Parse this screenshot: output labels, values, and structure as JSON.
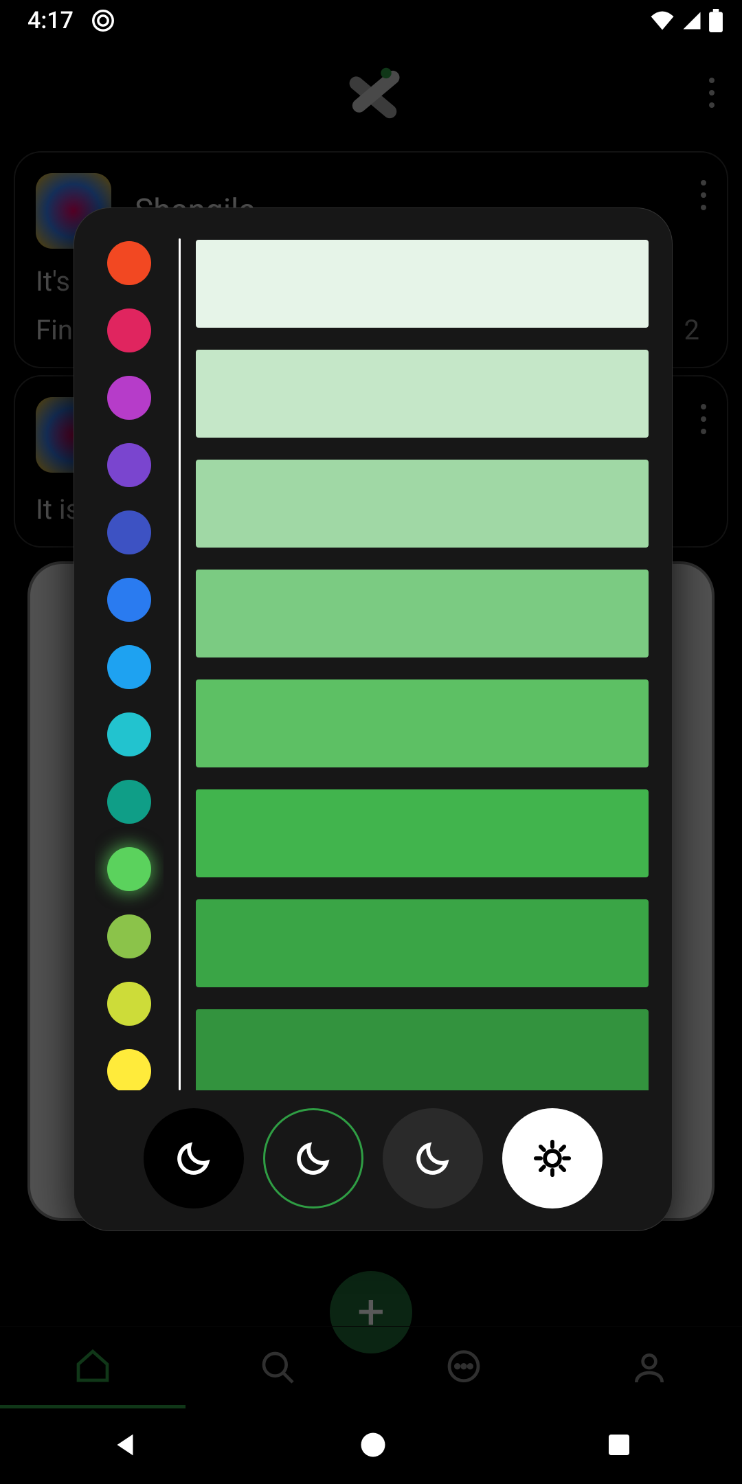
{
  "status_bar": {
    "time": "4:17",
    "icons": {
      "screensaver": "screensaver-icon",
      "wifi": "wifi-icon",
      "signal": "signal-icon",
      "battery": "battery-icon"
    }
  },
  "backdrop": {
    "cards": [
      {
        "title": "Shangila",
        "lines": [
          "It's t",
          "Fina"
        ],
        "badge": "2"
      },
      {
        "lines": [
          "It is"
        ]
      }
    ],
    "fab_label": "+",
    "nav": [
      "home",
      "search",
      "chat",
      "profile"
    ]
  },
  "color_picker": {
    "hues": [
      {
        "name": "red",
        "color": "#f24822"
      },
      {
        "name": "pink",
        "color": "#e0255f"
      },
      {
        "name": "magenta",
        "color": "#b63cc9"
      },
      {
        "name": "purple",
        "color": "#7a45cf"
      },
      {
        "name": "indigo",
        "color": "#3d52c3"
      },
      {
        "name": "blue",
        "color": "#2a7bf0"
      },
      {
        "name": "sky",
        "color": "#1ea2f1"
      },
      {
        "name": "cyan",
        "color": "#22c3cf"
      },
      {
        "name": "teal",
        "color": "#0f9e87"
      },
      {
        "name": "green",
        "color": "#5bd25d",
        "selected": true
      },
      {
        "name": "lime",
        "color": "#8bc34a"
      },
      {
        "name": "yellowgreen",
        "color": "#cddc39"
      },
      {
        "name": "yellow",
        "color": "#ffeb3b"
      }
    ],
    "shades": [
      "#e6f4e8",
      "#c5e7c8",
      "#a0d8a5",
      "#7bcb82",
      "#5dc064",
      "#41b44d",
      "#3aa546",
      "#33933e"
    ],
    "modes": [
      {
        "name": "black-theme",
        "kind": "moon",
        "style": "mode-black"
      },
      {
        "name": "dark-theme",
        "kind": "moon",
        "style": "mode-dark-sel",
        "selected": true
      },
      {
        "name": "grey-theme",
        "kind": "moon",
        "style": "mode-grey"
      },
      {
        "name": "light-theme",
        "kind": "sun",
        "style": "mode-light"
      }
    ]
  }
}
